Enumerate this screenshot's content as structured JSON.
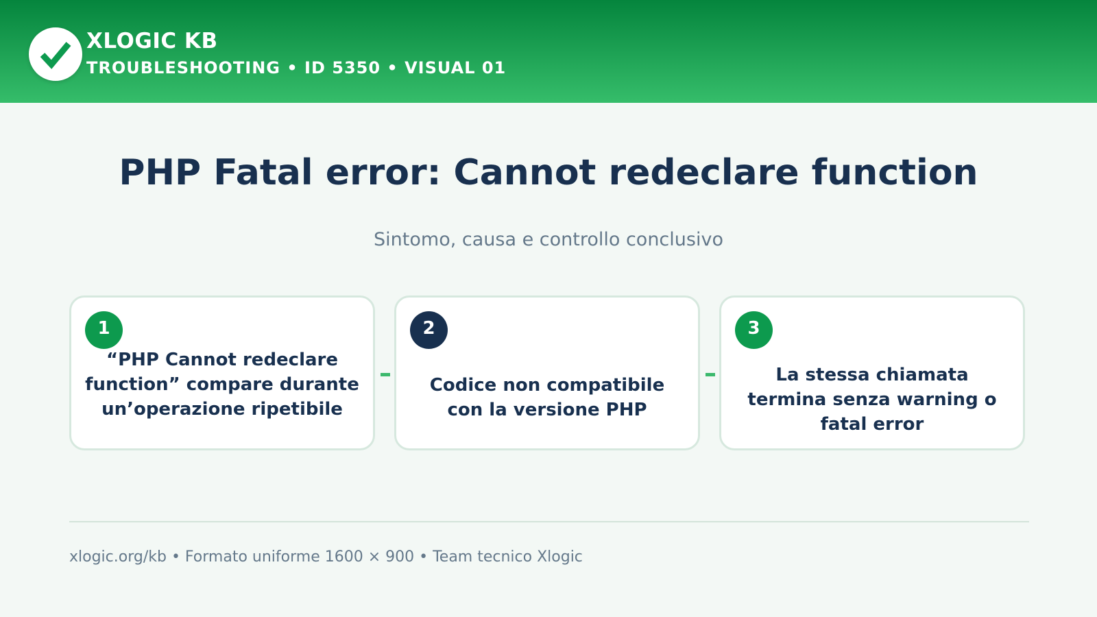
{
  "header": {
    "brand": "XLOGIC KB",
    "breadcrumb": "TROUBLESHOOTING • ID 5350 • VISUAL 01",
    "logo_icon": "check-icon",
    "colors": {
      "gradient_top": "#05853d",
      "gradient_bottom": "#35bd6a"
    }
  },
  "main": {
    "title": "PHP Fatal error: Cannot redeclare function",
    "subtitle": "Sintomo, causa e controllo conclusivo"
  },
  "steps": [
    {
      "number": "1",
      "text": "“PHP Cannot redeclare function” compare durante un’operazione ripetibile",
      "color": "#0d9a4e"
    },
    {
      "number": "2",
      "text": "Codice non compatibile con la versione PHP",
      "color": "#18304f"
    },
    {
      "number": "3",
      "text": "La stessa chiamata termina senza warning o fatal error",
      "color": "#0d9a4e"
    }
  ],
  "footer": {
    "text": "xlogic.org/kb • Formato uniforme 1600 × 900 • Team tecnico Xlogic"
  }
}
